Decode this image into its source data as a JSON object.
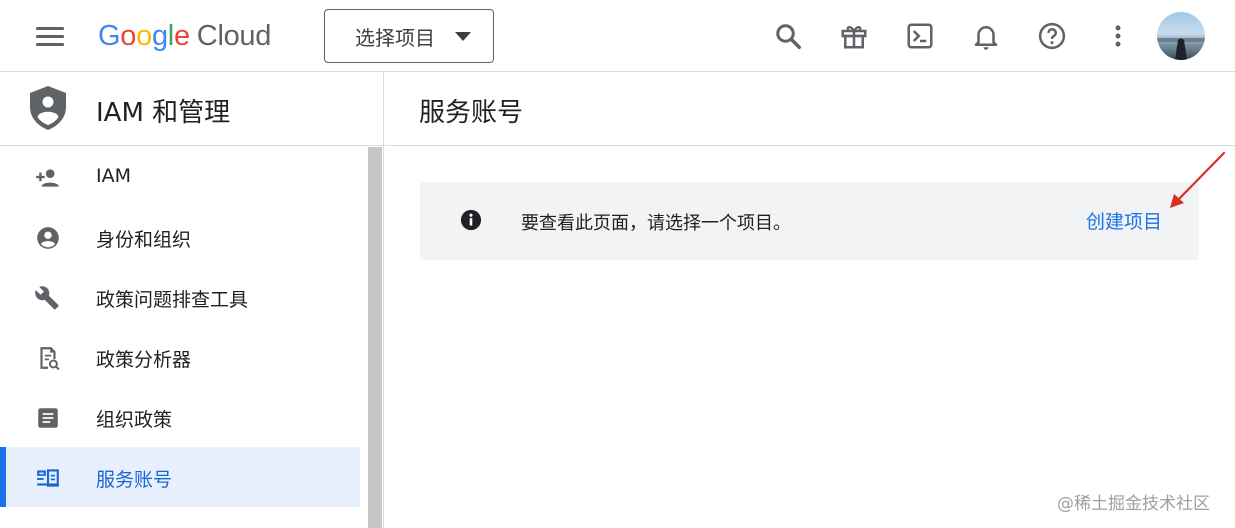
{
  "topbar": {
    "logo": {
      "g1": "G",
      "g2": "o",
      "g3": "o",
      "g4": "g",
      "g5": "l",
      "g6": "e",
      "cloud": "Cloud"
    },
    "project_selector": "选择项目",
    "icons": [
      "search-icon",
      "gift-icon",
      "cloud-shell-icon",
      "notifications-icon",
      "help-icon",
      "more-vert-icon",
      "avatar"
    ]
  },
  "sidebar": {
    "title": "IAM 和管理",
    "items": [
      {
        "label": "IAM",
        "icon": "person-add-icon"
      },
      {
        "label": "身份和组织",
        "icon": "account-circle-icon"
      },
      {
        "label": "政策问题排查工具",
        "icon": "wrench-icon"
      },
      {
        "label": "政策分析器",
        "icon": "policy-analyzer-icon"
      },
      {
        "label": "组织政策",
        "icon": "article-icon"
      },
      {
        "label": "服务账号",
        "icon": "service-account-icon",
        "active": true
      }
    ]
  },
  "main": {
    "title": "服务账号",
    "banner": {
      "message": "要查看此页面，请选择一个项目。",
      "link": "创建项目"
    }
  },
  "watermark": "@稀土掘金技术社区",
  "colors": {
    "accent": "#1a73e8",
    "active_bg": "#e8f0fe",
    "banner_bg": "#f1f3f4",
    "arrow": "#d93025"
  }
}
